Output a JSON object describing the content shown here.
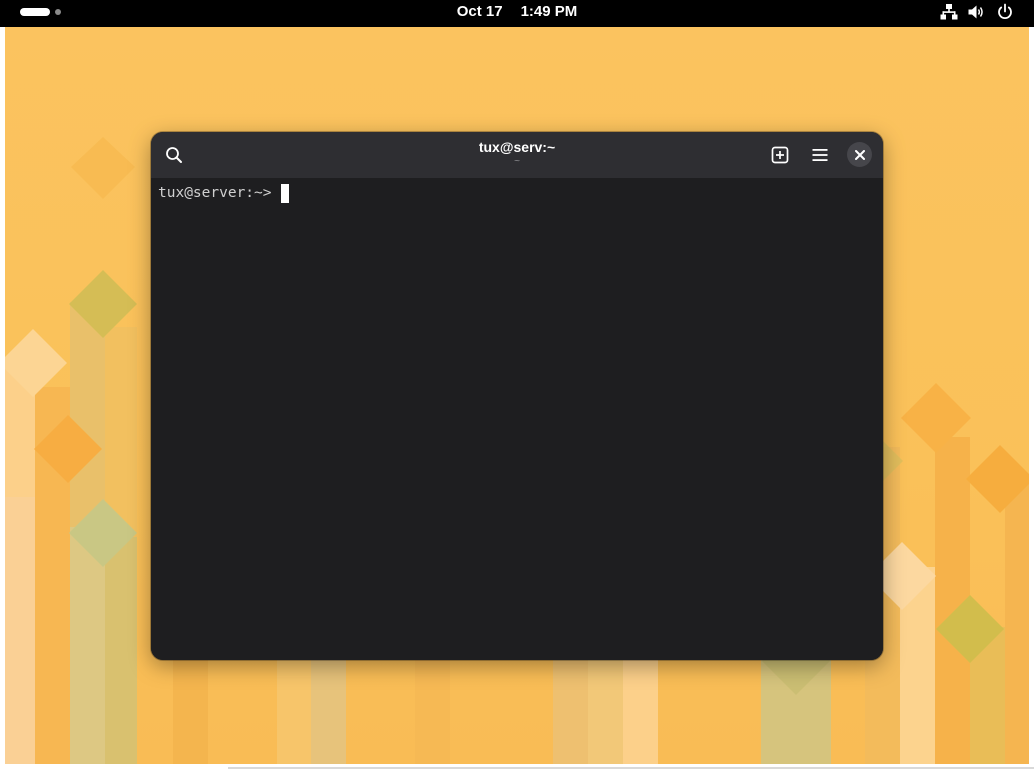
{
  "topbar": {
    "date": "Oct 17",
    "time": "1:49 PM",
    "tray_icons": [
      "network-wired-icon",
      "speaker-volume-icon",
      "power-icon"
    ]
  },
  "terminal": {
    "title": "tux@serv:~",
    "subtitle": "~",
    "prompt": "tux@server:~>",
    "header_icons": [
      "search-icon",
      "new-tab-icon",
      "hamburger-menu-icon",
      "close-icon"
    ]
  },
  "colors": {
    "wallpaper": "#fbc35f",
    "titlebar": "#2e2e32",
    "terminal_bg": "#1e1e20",
    "prompt_text": "#d0d0d0"
  }
}
